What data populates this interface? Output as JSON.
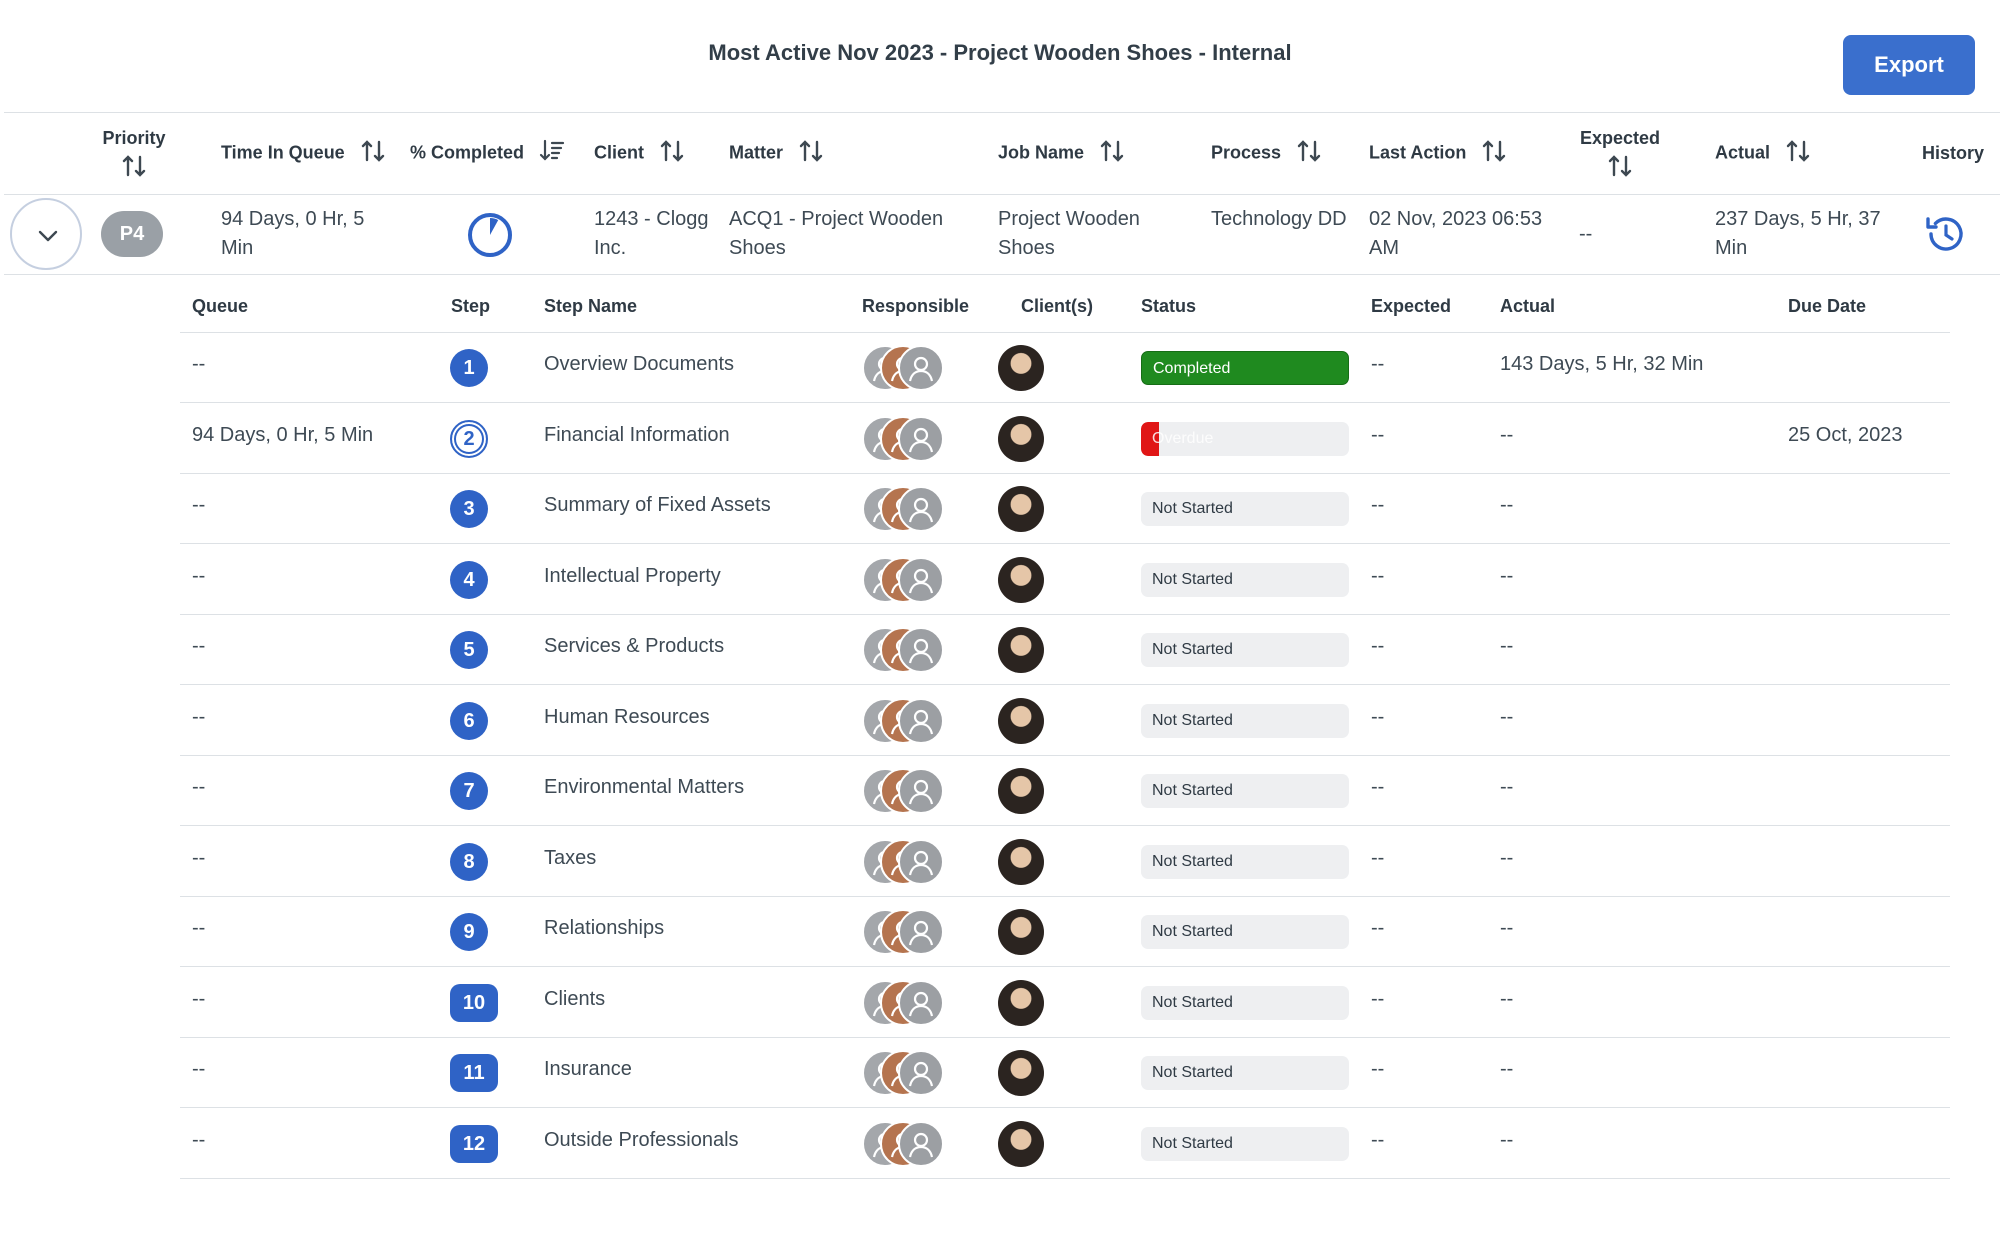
{
  "title": "Most Active Nov 2023 - Project Wooden Shoes - Internal",
  "export_label": "Export",
  "columns": {
    "priority": "Priority",
    "time_in_queue": "Time In Queue",
    "percent_completed": "% Completed",
    "client": "Client",
    "matter": "Matter",
    "job_name": "Job Name",
    "process": "Process",
    "last_action": "Last Action",
    "expected": "Expected",
    "actual": "Actual",
    "history": "History"
  },
  "job": {
    "priority": "P4",
    "time_in_queue": "94 Days, 0 Hr, 5 Min",
    "percent_completed": 0.08,
    "client": "1243 - Clogg Inc.",
    "matter": "ACQ1 - Project Wooden Shoes",
    "job_name": "Project Wooden Shoes",
    "process": "Technology DD",
    "last_action": "02 Nov, 2023 06:53 AM",
    "expected": "--",
    "actual": "237 Days, 5 Hr, 37 Min"
  },
  "step_columns": {
    "queue": "Queue",
    "step": "Step",
    "step_name": "Step Name",
    "responsible": "Responsible",
    "clients": "Client(s)",
    "status": "Status",
    "expected": "Expected",
    "actual": "Actual",
    "due_date": "Due Date"
  },
  "steps": [
    {
      "queue": "--",
      "step": "1",
      "name": "Overview Documents",
      "status": "Completed",
      "expected": "--",
      "actual": "143 Days, 5 Hr, 32 Min",
      "due": ""
    },
    {
      "queue": "94 Days, 0 Hr, 5 Min",
      "step": "2",
      "name": "Financial Information",
      "status": "Overdue",
      "expected": "--",
      "actual": "--",
      "due": "25 Oct, 2023"
    },
    {
      "queue": "--",
      "step": "3",
      "name": "Summary of Fixed Assets",
      "status": "Not Started",
      "expected": "--",
      "actual": "--",
      "due": ""
    },
    {
      "queue": "--",
      "step": "4",
      "name": "Intellectual Property",
      "status": "Not Started",
      "expected": "--",
      "actual": "--",
      "due": ""
    },
    {
      "queue": "--",
      "step": "5",
      "name": "Services & Products",
      "status": "Not Started",
      "expected": "--",
      "actual": "--",
      "due": ""
    },
    {
      "queue": "--",
      "step": "6",
      "name": "Human Resources",
      "status": "Not Started",
      "expected": "--",
      "actual": "--",
      "due": ""
    },
    {
      "queue": "--",
      "step": "7",
      "name": "Environmental Matters",
      "status": "Not Started",
      "expected": "--",
      "actual": "--",
      "due": ""
    },
    {
      "queue": "--",
      "step": "8",
      "name": "Taxes",
      "status": "Not Started",
      "expected": "--",
      "actual": "--",
      "due": ""
    },
    {
      "queue": "--",
      "step": "9",
      "name": "Relationships",
      "status": "Not Started",
      "expected": "--",
      "actual": "--",
      "due": ""
    },
    {
      "queue": "--",
      "step": "10",
      "name": "Clients",
      "status": "Not Started",
      "expected": "--",
      "actual": "--",
      "due": ""
    },
    {
      "queue": "--",
      "step": "11",
      "name": "Insurance",
      "status": "Not Started",
      "expected": "--",
      "actual": "--",
      "due": ""
    },
    {
      "queue": "--",
      "step": "12",
      "name": "Outside Professionals",
      "status": "Not Started",
      "expected": "--",
      "actual": "--",
      "due": ""
    }
  ],
  "icons": {
    "expand": "chevron-down-icon",
    "sort": "sort-arrows-icon",
    "sort_active": "sort-descending-icon",
    "progress": "pie-progress-icon",
    "history": "history-icon",
    "avatar": "user-avatar-icon"
  },
  "colors": {
    "accent": "#3a6fcd",
    "completed": "#1f8a1f",
    "overdue": "#e01616",
    "not_started": "#eeeff1"
  }
}
